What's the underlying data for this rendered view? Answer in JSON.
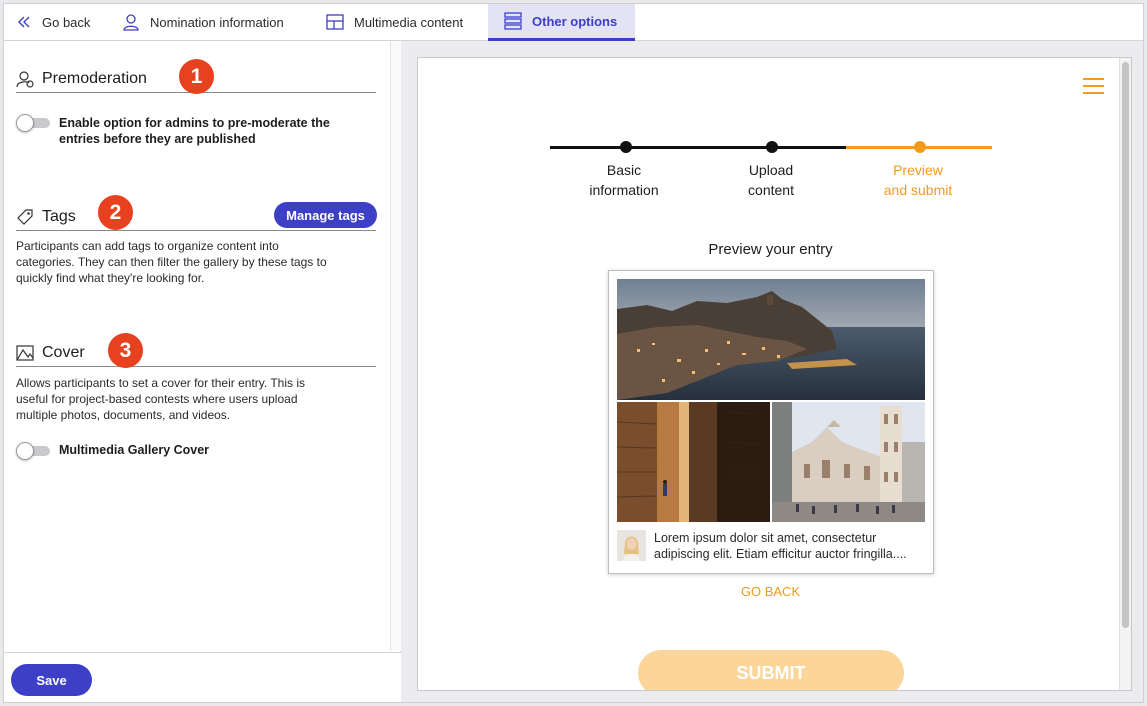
{
  "tabs": {
    "back": "Go back",
    "nomination": "Nomination information",
    "multimedia": "Multimedia content",
    "other": "Other options"
  },
  "premoderation": {
    "title": "Premoderation",
    "badge": "1",
    "toggle_label_1": "Enable option for admins to pre-moderate the",
    "toggle_label_2": "entries before they are published",
    "enabled": false
  },
  "tags": {
    "title": "Tags",
    "badge": "2",
    "manage_button": "Manage tags",
    "desc_1": "Participants can add tags to organize content into",
    "desc_2": "categories. They can then filter the gallery by these tags to",
    "desc_3": "quickly find what they're looking for."
  },
  "cover": {
    "title": "Cover",
    "badge": "3",
    "desc_1": "Allows participants to set a cover for their entry. This is",
    "desc_2": "useful for project-based contests where users upload",
    "desc_3": "multiple photos, documents, and videos.",
    "toggle_label": "Multimedia Gallery Cover",
    "enabled": false
  },
  "footer": {
    "save": "Save"
  },
  "preview": {
    "steps": [
      {
        "line1": "Basic",
        "line2": "information"
      },
      {
        "line1": "Upload",
        "line2": "content"
      },
      {
        "line1": "Preview",
        "line2": "and submit"
      }
    ],
    "active_step": 3,
    "title": "Preview your entry",
    "entry_text_1": "Lorem ipsum dolor sit amet, consectetur",
    "entry_text_2": "adipiscing elit. Etiam efficitur auctor fringilla....",
    "go_back": "GO BACK",
    "submit": "SUBMIT"
  },
  "colors": {
    "accent": "#3d3fc7",
    "badge": "#e8411f",
    "orange": "#f49a1c",
    "submit_disabled": "#fbd59a"
  }
}
